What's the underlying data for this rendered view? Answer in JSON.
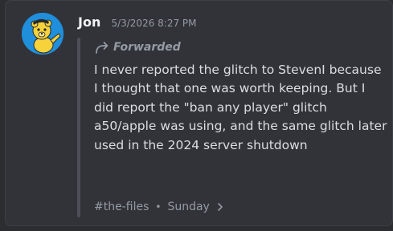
{
  "message": {
    "author": "Jon",
    "timestamp": "5/3/2026 8:27 PM",
    "forwarded_label": "Forwarded",
    "body": "I never reported the glitch to StevenI because I thought that one was worth keeping. But I did report the \"ban any player\" glitch a50/apple was using, and the same glitch later used in the 2024 server shutdown",
    "channel": "#the-files",
    "separator": "•",
    "day": "Sunday",
    "avatar_icon": "yellow-cartoon-bear-avatar",
    "forward_icon": "forward-arrow-icon",
    "chevron_icon": "chevron-right-icon"
  },
  "colors": {
    "background": "#2b2d31",
    "card": "#323339",
    "author": "#f2f3f5",
    "muted": "#949ba4",
    "text": "#dbdee1",
    "avatar_bg": "#1f8fdc",
    "avatar_character": "#f7d23b"
  }
}
